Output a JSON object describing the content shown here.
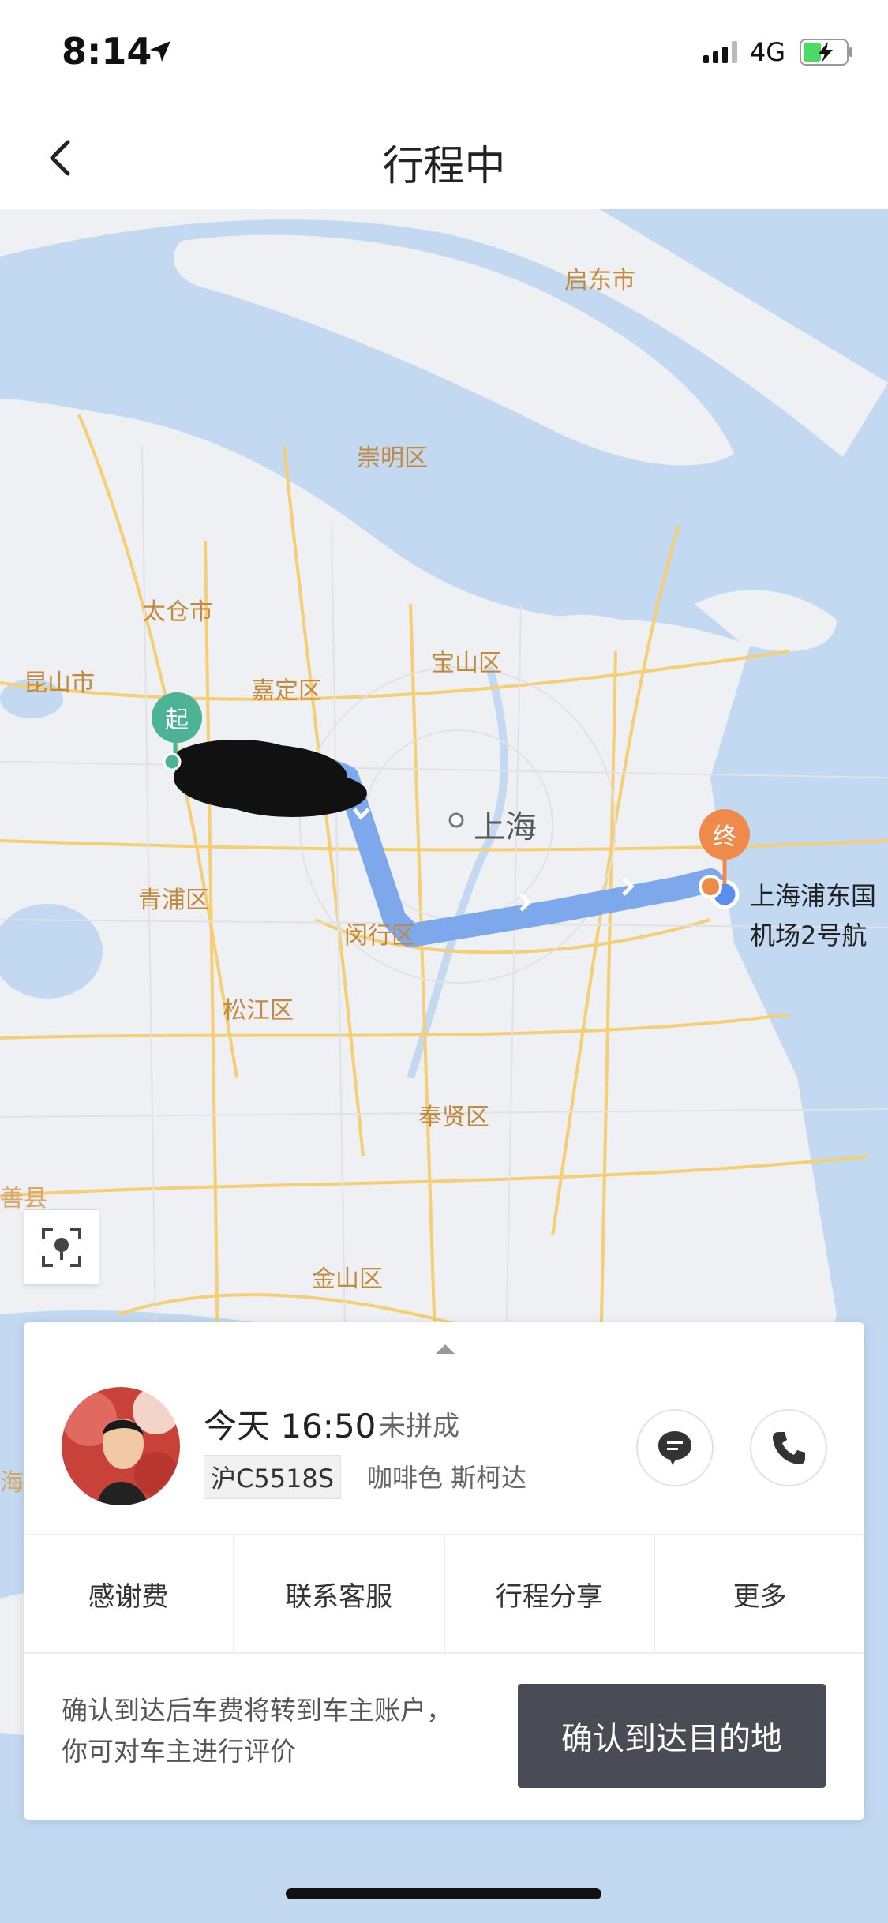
{
  "status_bar": {
    "time": "8:14",
    "network": "4G",
    "icons": [
      "location-arrow-icon",
      "signal-icon",
      "battery-charging-icon"
    ]
  },
  "nav": {
    "title": "行程中",
    "back_icon": "chevron-left-icon"
  },
  "map": {
    "labels": {
      "qidong": "启东市",
      "chongming": "崇明区",
      "taicang": "太仓市",
      "kunshan": "昆山市",
      "jiading": "嘉定区",
      "baoshan": "宝山区",
      "shanghai": "上海",
      "qingpu": "青浦区",
      "minhang": "闵行区",
      "songjiang": "松江区",
      "fengxian": "奉贤区",
      "jinshan": "金山区",
      "jiashan": "善县",
      "pinghu": "海"
    },
    "start_pin": "起",
    "end_pin": "终",
    "destination_line1": "上海浦东国",
    "destination_line2": "机场2号航"
  },
  "trip": {
    "time": "今天 16:50",
    "pool_status": "未拼成",
    "plate": "沪C5518S",
    "car_desc": "咖啡色 斯柯达"
  },
  "actions": [
    "感谢费",
    "联系客服",
    "行程分享",
    "更多"
  ],
  "confirm": {
    "note": "确认到达后车费将转到车主账户，你可对车主进行评价",
    "button": "确认到达目的地"
  },
  "colors": {
    "route": "#7ea8ec",
    "start": "#4db395",
    "end": "#f08a4b",
    "water": "#c3d9f2",
    "road": "#f4cf73"
  }
}
